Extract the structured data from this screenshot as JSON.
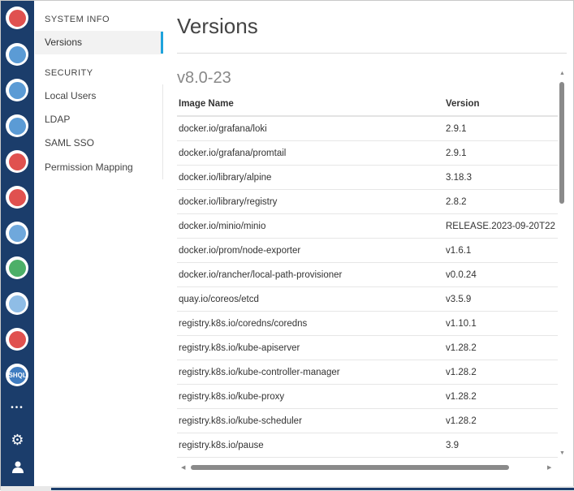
{
  "rail": {
    "apps": [
      {
        "icon": "app-1-icon",
        "color": "#e0514f"
      },
      {
        "icon": "app-2-icon",
        "color": "#5b9bd5"
      },
      {
        "icon": "app-3-icon",
        "color": "#5b9bd5"
      },
      {
        "icon": "app-4-icon",
        "color": "#5b9bd5"
      },
      {
        "icon": "app-5-icon",
        "color": "#e0514f"
      },
      {
        "icon": "app-6-icon",
        "color": "#e0514f"
      },
      {
        "icon": "app-7-icon",
        "color": "#6fa8dc"
      },
      {
        "icon": "app-8-icon",
        "color": "#4caf68"
      },
      {
        "icon": "app-9-icon",
        "color": "#8fbde6"
      },
      {
        "icon": "app-10-icon",
        "color": "#e0514f"
      },
      {
        "icon": "shql-icon",
        "color": "#3f7cc0",
        "label": "SHQL"
      }
    ],
    "more": "•••",
    "settings": "⚙",
    "user": "👤"
  },
  "nav": {
    "sections": [
      {
        "title": "SYSTEM INFO",
        "items": [
          "Versions"
        ]
      },
      {
        "title": "SECURITY",
        "items": [
          "Local Users",
          "LDAP",
          "SAML SSO",
          "Permission Mapping"
        ]
      }
    ]
  },
  "main": {
    "title": "Versions",
    "version": "v8.0-23",
    "columns": [
      "Image Name",
      "Version"
    ],
    "rows": [
      [
        "docker.io/grafana/loki",
        "2.9.1"
      ],
      [
        "docker.io/grafana/promtail",
        "2.9.1"
      ],
      [
        "docker.io/library/alpine",
        "3.18.3"
      ],
      [
        "docker.io/library/registry",
        "2.8.2"
      ],
      [
        "docker.io/minio/minio",
        "RELEASE.2023-09-20T22"
      ],
      [
        "docker.io/prom/node-exporter",
        "v1.6.1"
      ],
      [
        "docker.io/rancher/local-path-provisioner",
        "v0.0.24"
      ],
      [
        "quay.io/coreos/etcd",
        "v3.5.9"
      ],
      [
        "registry.k8s.io/coredns/coredns",
        "v1.10.1"
      ],
      [
        "registry.k8s.io/kube-apiserver",
        "v1.28.2"
      ],
      [
        "registry.k8s.io/kube-controller-manager",
        "v1.28.2"
      ],
      [
        "registry.k8s.io/kube-proxy",
        "v1.28.2"
      ],
      [
        "registry.k8s.io/kube-scheduler",
        "v1.28.2"
      ],
      [
        "registry.k8s.io/pause",
        "3.9"
      ]
    ]
  }
}
